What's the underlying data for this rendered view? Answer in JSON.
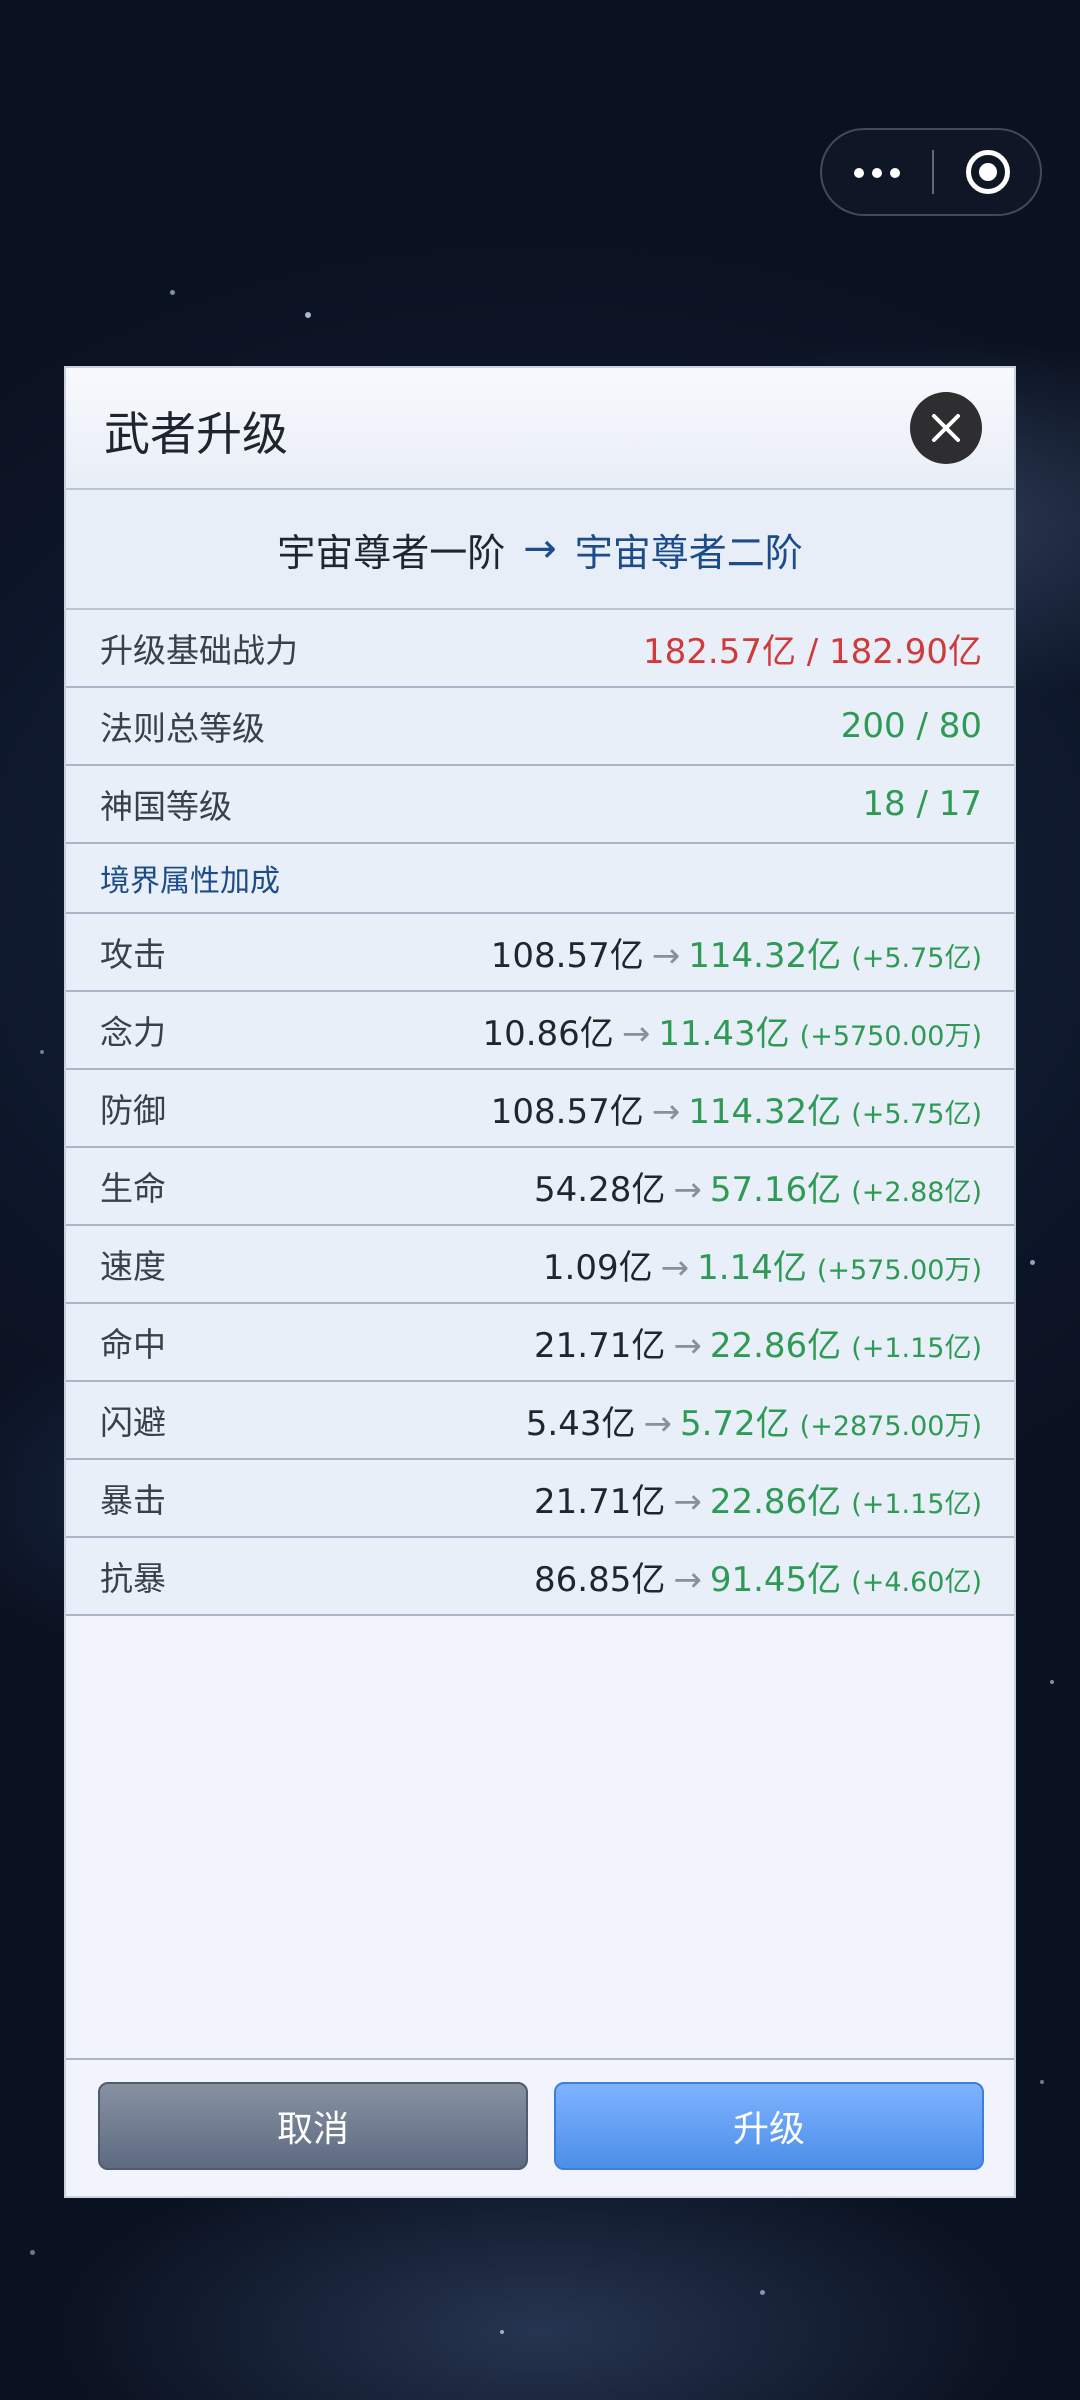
{
  "capsule": {
    "more_icon": "more-dots-icon",
    "target_icon": "target-icon"
  },
  "dialog": {
    "title": "武者升级",
    "close_icon": "close-icon",
    "rank": {
      "from": "宇宙尊者一阶",
      "arrow": "→",
      "to": "宇宙尊者二阶"
    },
    "requirements": [
      {
        "label": "升级基础战力",
        "value": "182.57亿 / 182.90亿",
        "status": "insufficient"
      },
      {
        "label": "法则总等级",
        "value": "200 / 80",
        "status": "met"
      },
      {
        "label": "神国等级",
        "value": "18 / 17",
        "status": "met"
      }
    ],
    "section_title": "境界属性加成",
    "attributes": [
      {
        "label": "攻击",
        "old": "108.57亿",
        "new": "114.32亿",
        "delta": "(+5.75亿)"
      },
      {
        "label": "念力",
        "old": "10.86亿",
        "new": "11.43亿",
        "delta": "(+5750.00万)"
      },
      {
        "label": "防御",
        "old": "108.57亿",
        "new": "114.32亿",
        "delta": "(+5.75亿)"
      },
      {
        "label": "生命",
        "old": "54.28亿",
        "new": "57.16亿",
        "delta": "(+2.88亿)"
      },
      {
        "label": "速度",
        "old": "1.09亿",
        "new": "1.14亿",
        "delta": "(+575.00万)"
      },
      {
        "label": "命中",
        "old": "21.71亿",
        "new": "22.86亿",
        "delta": "(+1.15亿)"
      },
      {
        "label": "闪避",
        "old": "5.43亿",
        "new": "5.72亿",
        "delta": "(+2875.00万)"
      },
      {
        "label": "暴击",
        "old": "21.71亿",
        "new": "22.86亿",
        "delta": "(+1.15亿)"
      },
      {
        "label": "抗暴",
        "old": "86.85亿",
        "new": "91.45亿",
        "delta": "(+4.60亿)"
      }
    ],
    "attr_arrow": "→",
    "buttons": {
      "cancel": "取消",
      "upgrade": "升级"
    }
  },
  "colors": {
    "insufficient": "#cf3b3b",
    "met": "#2e9a55",
    "accent": "#1c4c89",
    "upgrade_button": "#5b9af0",
    "cancel_button": "#6c778a"
  }
}
